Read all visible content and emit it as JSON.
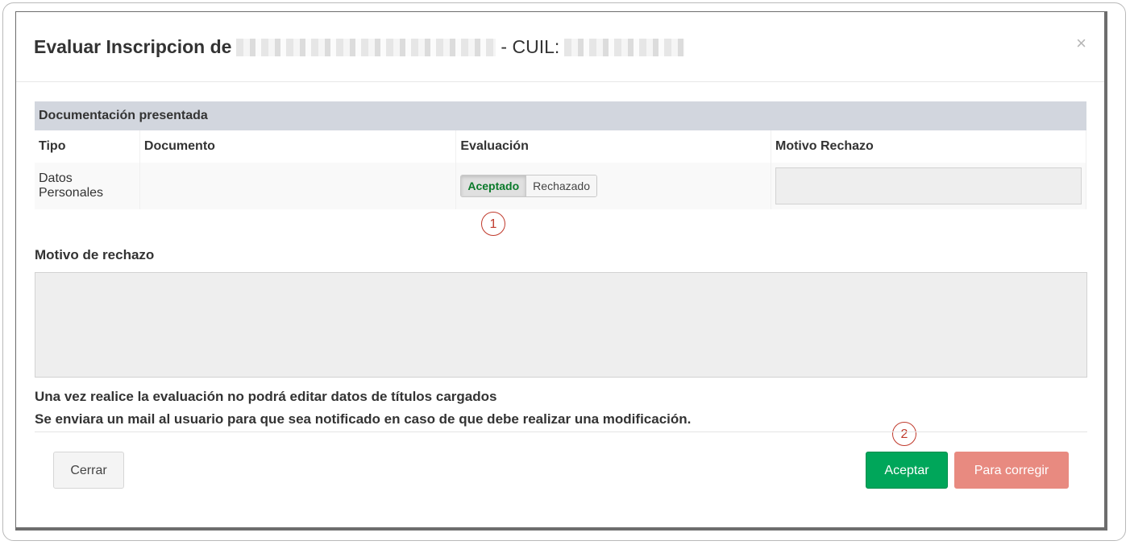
{
  "modal": {
    "title_prefix": "Evaluar Inscripcion de",
    "cuil_label": "- CUIL:",
    "close_symbol": "×"
  },
  "table": {
    "caption": "Documentación presentada",
    "headers": [
      "Tipo",
      "Documento",
      "Evaluación",
      "Motivo Rechazo"
    ],
    "rows": [
      {
        "tipo": "Datos Personales",
        "documento": "",
        "evaluacion_options": [
          "Aceptado",
          "Rechazado"
        ],
        "selected": "Aceptado",
        "motivo": ""
      }
    ]
  },
  "markers": [
    "1",
    "2"
  ],
  "rejection": {
    "label": "Motivo de rechazo",
    "value": ""
  },
  "notes": [
    "Una vez realice la evaluación no podrá editar datos de títulos cargados",
    "Se enviara un mail al usuario para que sea notificado en caso de que debe realizar una modificación."
  ],
  "buttons": {
    "close": "Cerrar",
    "accept": "Aceptar",
    "correct": "Para corregir"
  },
  "colors": {
    "accept": "#00a65a",
    "correct": "#e88a80",
    "accepted_text": "#0a7a2a",
    "marker": "#c0392b",
    "table_caption_bg": "#d2d6de"
  }
}
